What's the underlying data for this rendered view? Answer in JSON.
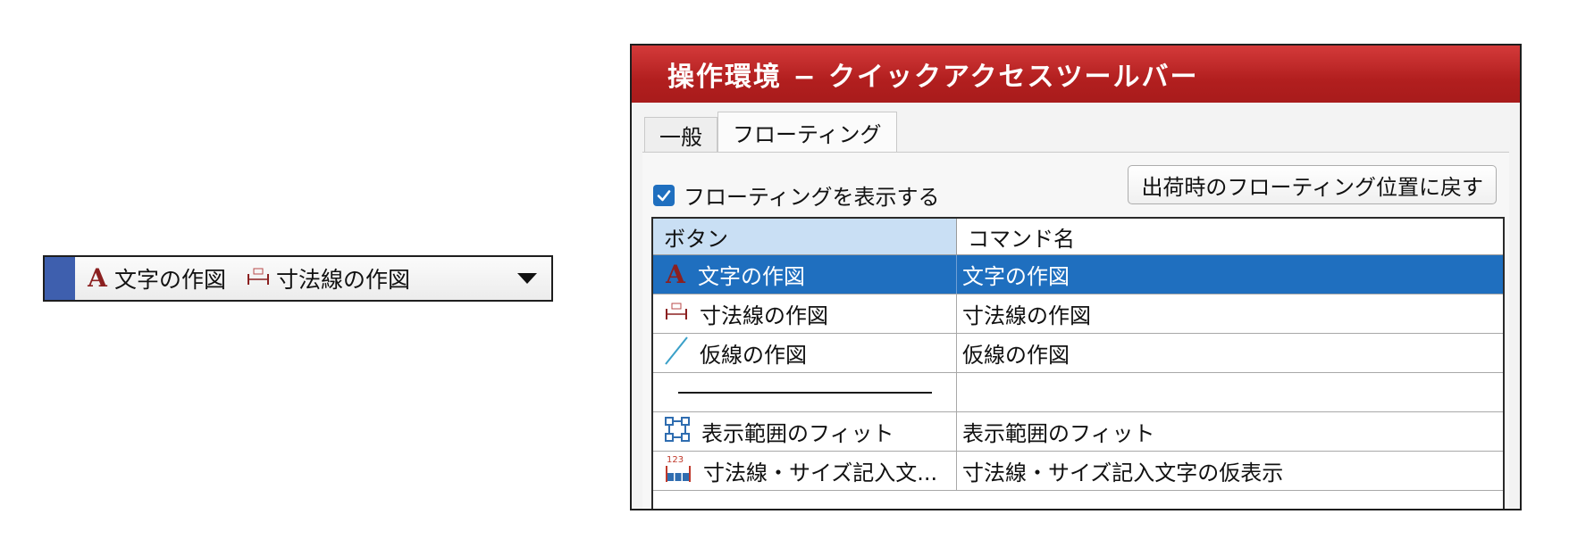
{
  "floating_toolbar": {
    "items": [
      {
        "icon": "text-a-icon",
        "label": "文字の作図"
      },
      {
        "icon": "dimension-line-icon",
        "label": "寸法線の作図"
      }
    ]
  },
  "dialog": {
    "title": "操作環境 − クイックアクセスツールバー",
    "tabs": [
      {
        "label": "一般",
        "active": false
      },
      {
        "label": "フローティング",
        "active": true
      }
    ],
    "show_floating": {
      "label": "フローティングを表示する",
      "checked": true
    },
    "reset_button": "出荷時のフローティング位置に戻す",
    "table": {
      "headers": [
        "ボタン",
        "コマンド名"
      ],
      "rows": [
        {
          "icon": "text-a-icon",
          "button": "文字の作図",
          "command": "文字の作図",
          "selected": true
        },
        {
          "icon": "dimension-line-icon",
          "button": "寸法線の作図",
          "command": "寸法線の作図"
        },
        {
          "icon": "construction-line-icon",
          "button": "仮線の作図",
          "command": "仮線の作図"
        },
        {
          "icon": "separator",
          "button": "",
          "command": ""
        },
        {
          "icon": "fit-view-icon",
          "button": "表示範囲のフィット",
          "command": "表示範囲のフィット"
        },
        {
          "icon": "dimension-size-icon",
          "button": "寸法線・サイズ記入文...",
          "command": "寸法線・サイズ記入文字の仮表示"
        }
      ]
    }
  },
  "colors": {
    "title_bar": "#b21f1f",
    "selection": "#1f6fbf",
    "header_highlight": "#c9dff4",
    "toolbar_grip": "#3e5fae"
  }
}
